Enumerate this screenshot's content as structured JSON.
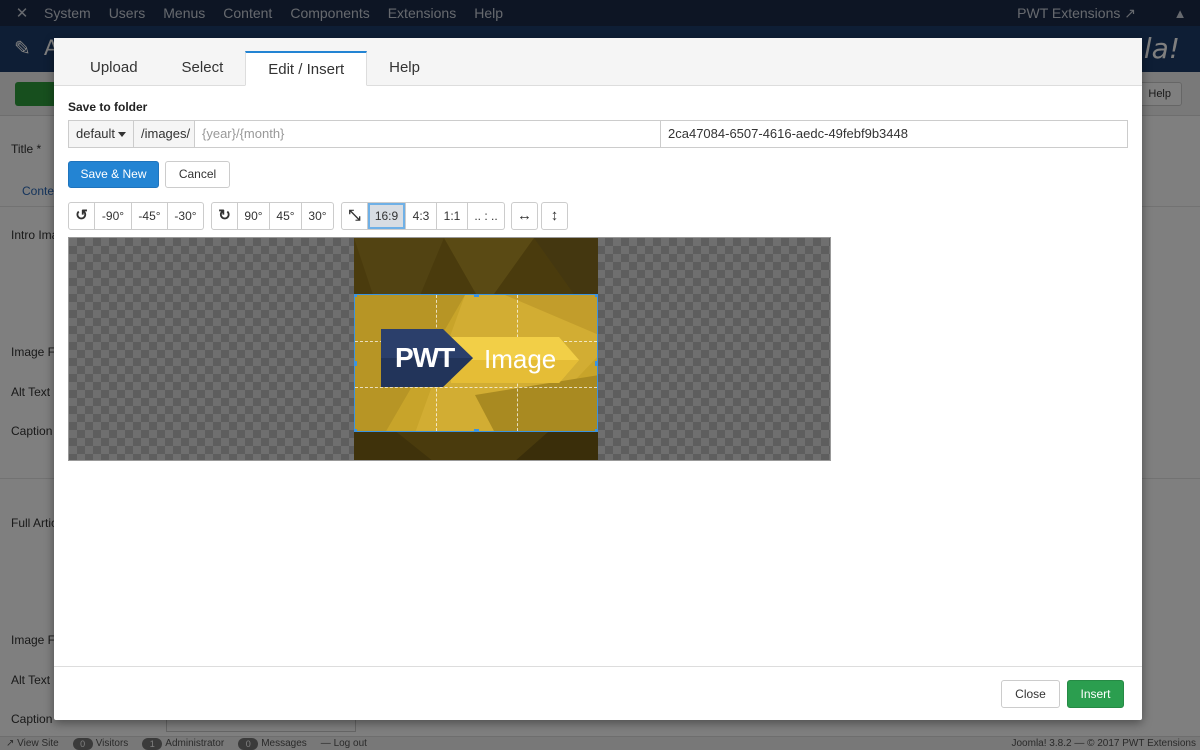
{
  "topbar": {
    "menu": [
      "System",
      "Users",
      "Menus",
      "Content",
      "Components",
      "Extensions",
      "Help"
    ],
    "right_link": "PWT Extensions"
  },
  "background": {
    "header_title": "A",
    "joomla_word": "la!",
    "help_button": "Help",
    "labels": {
      "title": "Title *",
      "tab_content": "Conten",
      "intro_image": "Intro Ima",
      "image_float_1": "Image Fl",
      "alt_text_1": "Alt Text",
      "caption_1": "Caption",
      "full_article": "Full Artic",
      "image_float_2": "Image Fl",
      "alt_text_2": "Alt Text",
      "caption_2": "Caption"
    },
    "status": {
      "view_site": "View Site",
      "visitors_count": "0",
      "visitors": "Visitors",
      "admin_count": "1",
      "administrator": "Administrator",
      "messages_count": "0",
      "messages": "Messages",
      "logout": "Log out",
      "right": "Joomla! 3.8.2  —  © 2017 PWT Extensions"
    }
  },
  "modal": {
    "tabs": [
      {
        "label": "Upload",
        "active": false
      },
      {
        "label": "Select",
        "active": false
      },
      {
        "label": "Edit / Insert",
        "active": true
      },
      {
        "label": "Help",
        "active": false
      }
    ],
    "save_to_folder": {
      "label": "Save to folder",
      "dropdown_value": "default",
      "prefix": "/images/",
      "subfolder_placeholder": "{year}/{month}",
      "filename": "2ca47084-6507-4616-aedc-49febf9b3448"
    },
    "save_new_button": "Save & New",
    "cancel_button": "Cancel",
    "toolbar": {
      "rotate_left": [
        "-90°",
        "-45°",
        "-30°"
      ],
      "rotate_right": [
        "90°",
        "45°",
        "30°"
      ],
      "ratios": [
        "16:9",
        "4:3",
        "1:1",
        ".. : .."
      ],
      "active_ratio": "16:9"
    },
    "image": {
      "logo_left_text": "PWT",
      "logo_right_text": "Image",
      "colors": {
        "accent": "#2384d3",
        "crop_border": "#3b93e0",
        "logo_dark": "#2b3f6b",
        "logo_yellow": "#f2cf47"
      }
    },
    "close_button": "Close",
    "insert_button": "Insert"
  }
}
